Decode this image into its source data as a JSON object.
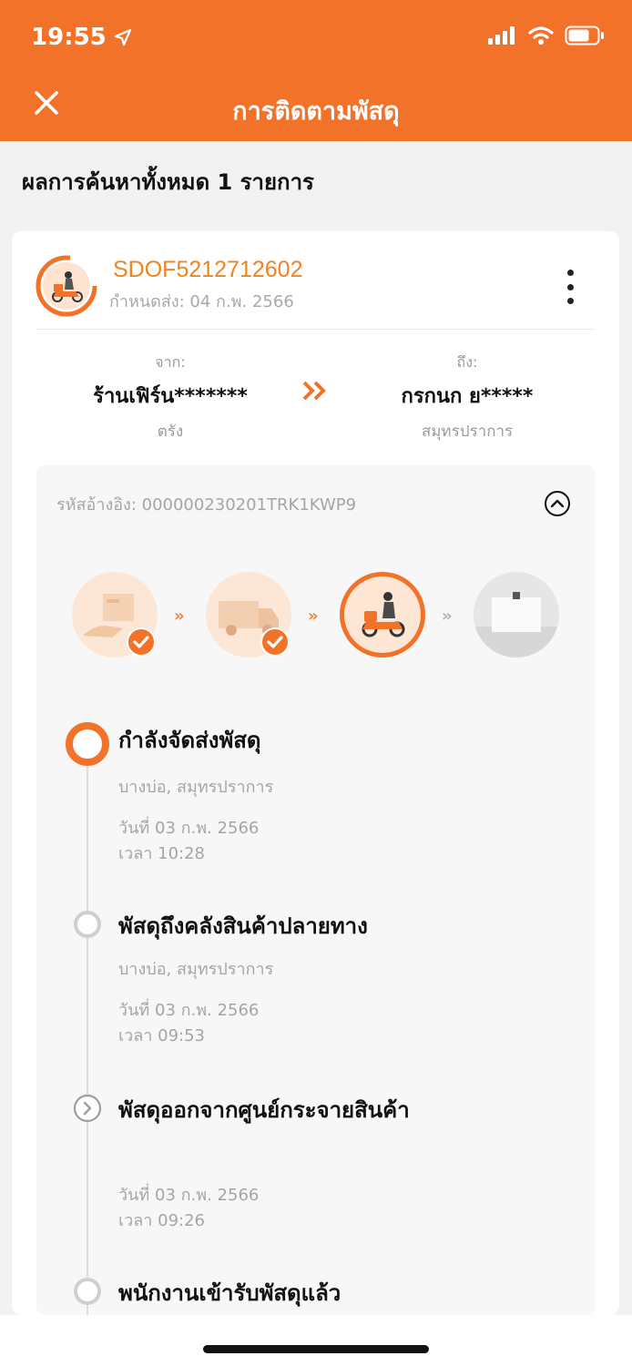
{
  "status_bar": {
    "time": "19:55"
  },
  "header": {
    "title": "การติดตามพัสดุ"
  },
  "result_count": "ผลการค้นหาทั้งหมด 1 รายการ",
  "parcel": {
    "tracking_no": "SDOF5212712602",
    "due_date": "กำหนดส่ง: 04 ก.พ. 2566",
    "from": {
      "label": "จาก:",
      "name": "ร้านเฟิร์น*******",
      "city": "ตรัง"
    },
    "to": {
      "label": "ถึง:",
      "name": "กรกนก ย*****",
      "city": "สมุทรปราการ"
    },
    "reference": "รหัสอ้างอิง: 000000230201TRK1KWP9",
    "progress_steps": [
      {
        "name": "picked-up",
        "done": true
      },
      {
        "name": "in-transit",
        "done": true
      },
      {
        "name": "out-for-delivery",
        "current": true
      },
      {
        "name": "delivered",
        "done": false
      }
    ],
    "events": [
      {
        "title": "กำลังจัดส่งพัสดุ",
        "location": "บางบ่อ, สมุทรปราการ",
        "date": "วันที่ 03 ก.พ. 2566",
        "time": "เวลา 10:28"
      },
      {
        "title": "พัสดุถึงคลังสินค้าปลายทาง",
        "location": "บางบ่อ, สมุทรปราการ",
        "date": "วันที่ 03 ก.พ. 2566",
        "time": "เวลา 09:53"
      },
      {
        "title": "พัสดุออกจากศูนย์กระจายสินค้า",
        "location": "",
        "date": "วันที่ 03 ก.พ. 2566",
        "time": "เวลา 09:26"
      },
      {
        "title": "พนักงานเข้ารับพัสดุแล้ว"
      }
    ]
  },
  "colors": {
    "brand": "#f3722a",
    "accent_text": "#f3821f",
    "muted": "#a5a5a5"
  }
}
